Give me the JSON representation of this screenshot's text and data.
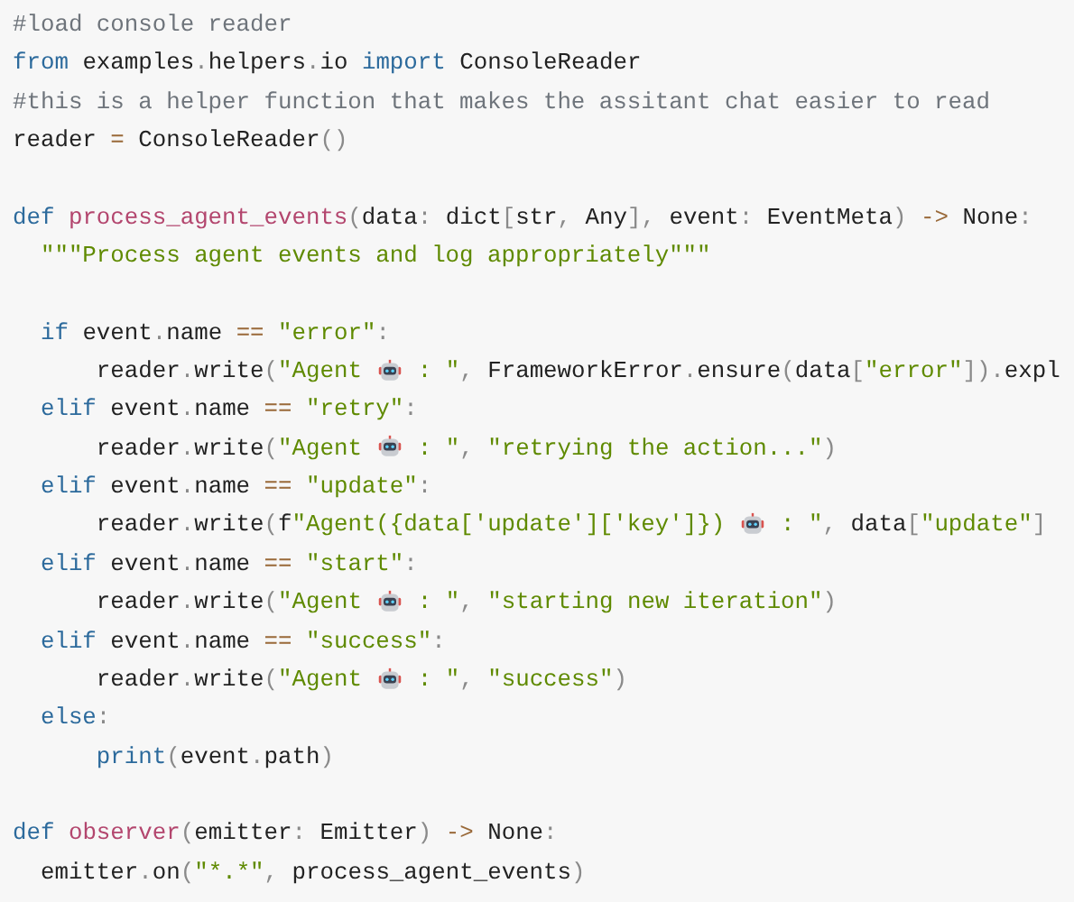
{
  "code_lines": [
    {
      "kind": "code",
      "tokens": [
        {
          "kind": "comment",
          "text": "#load console reader"
        }
      ]
    },
    {
      "kind": "code",
      "tokens": [
        {
          "kind": "keyword",
          "text": "from"
        },
        {
          "kind": "plain",
          "text": " examples"
        },
        {
          "kind": "punct",
          "text": "."
        },
        {
          "kind": "plain",
          "text": "helpers"
        },
        {
          "kind": "punct",
          "text": "."
        },
        {
          "kind": "plain",
          "text": "io "
        },
        {
          "kind": "keyword",
          "text": "import"
        },
        {
          "kind": "plain",
          "text": " ConsoleReader"
        }
      ]
    },
    {
      "kind": "code",
      "tokens": [
        {
          "kind": "comment",
          "text": "#this is a helper function that makes the assitant chat easier to read"
        }
      ]
    },
    {
      "kind": "code",
      "tokens": [
        {
          "kind": "plain",
          "text": "reader "
        },
        {
          "kind": "op",
          "text": "="
        },
        {
          "kind": "plain",
          "text": " ConsoleReader"
        },
        {
          "kind": "punct",
          "text": "()"
        }
      ]
    },
    {
      "kind": "blank"
    },
    {
      "kind": "code",
      "tokens": [
        {
          "kind": "keyword",
          "text": "def "
        },
        {
          "kind": "function",
          "text": "process_agent_events"
        },
        {
          "kind": "punct",
          "text": "("
        },
        {
          "kind": "plain",
          "text": "data"
        },
        {
          "kind": "punct",
          "text": ":"
        },
        {
          "kind": "plain",
          "text": " dict"
        },
        {
          "kind": "punct",
          "text": "["
        },
        {
          "kind": "plain",
          "text": "str"
        },
        {
          "kind": "punct",
          "text": ","
        },
        {
          "kind": "plain",
          "text": " Any"
        },
        {
          "kind": "punct",
          "text": "],"
        },
        {
          "kind": "plain",
          "text": " event"
        },
        {
          "kind": "punct",
          "text": ":"
        },
        {
          "kind": "plain",
          "text": " EventMeta"
        },
        {
          "kind": "punct",
          "text": ") "
        },
        {
          "kind": "op",
          "text": "->"
        },
        {
          "kind": "plain",
          "text": " None"
        },
        {
          "kind": "punct",
          "text": ":"
        }
      ]
    },
    {
      "kind": "code",
      "tokens": [
        {
          "kind": "string",
          "text": "  \"\"\"Process agent events and log appropriately\"\"\""
        }
      ]
    },
    {
      "kind": "blank"
    },
    {
      "kind": "code",
      "tokens": [
        {
          "kind": "keyword",
          "text": "  if"
        },
        {
          "kind": "plain",
          "text": " event"
        },
        {
          "kind": "punct",
          "text": "."
        },
        {
          "kind": "plain",
          "text": "name "
        },
        {
          "kind": "op",
          "text": "=="
        },
        {
          "kind": "string",
          "text": " \"error\""
        },
        {
          "kind": "punct",
          "text": ":"
        }
      ]
    },
    {
      "kind": "code",
      "tokens": [
        {
          "kind": "plain",
          "text": "      reader"
        },
        {
          "kind": "punct",
          "text": "."
        },
        {
          "kind": "plain",
          "text": "write"
        },
        {
          "kind": "punct",
          "text": "("
        },
        {
          "kind": "string",
          "text": "\"Agent "
        },
        {
          "kind": "robot"
        },
        {
          "kind": "string",
          "text": " : \""
        },
        {
          "kind": "punct",
          "text": ","
        },
        {
          "kind": "plain",
          "text": " FrameworkError"
        },
        {
          "kind": "punct",
          "text": "."
        },
        {
          "kind": "plain",
          "text": "ensure"
        },
        {
          "kind": "punct",
          "text": "("
        },
        {
          "kind": "plain",
          "text": "data"
        },
        {
          "kind": "punct",
          "text": "["
        },
        {
          "kind": "string",
          "text": "\"error\""
        },
        {
          "kind": "punct",
          "text": "])."
        },
        {
          "kind": "plain",
          "text": "expl"
        }
      ]
    },
    {
      "kind": "code",
      "tokens": [
        {
          "kind": "keyword",
          "text": "  elif"
        },
        {
          "kind": "plain",
          "text": " event"
        },
        {
          "kind": "punct",
          "text": "."
        },
        {
          "kind": "plain",
          "text": "name "
        },
        {
          "kind": "op",
          "text": "=="
        },
        {
          "kind": "string",
          "text": " \"retry\""
        },
        {
          "kind": "punct",
          "text": ":"
        }
      ]
    },
    {
      "kind": "code",
      "tokens": [
        {
          "kind": "plain",
          "text": "      reader"
        },
        {
          "kind": "punct",
          "text": "."
        },
        {
          "kind": "plain",
          "text": "write"
        },
        {
          "kind": "punct",
          "text": "("
        },
        {
          "kind": "string",
          "text": "\"Agent "
        },
        {
          "kind": "robot"
        },
        {
          "kind": "string",
          "text": " : \""
        },
        {
          "kind": "punct",
          "text": ","
        },
        {
          "kind": "string",
          "text": " \"retrying the action...\""
        },
        {
          "kind": "punct",
          "text": ")"
        }
      ]
    },
    {
      "kind": "code",
      "tokens": [
        {
          "kind": "keyword",
          "text": "  elif"
        },
        {
          "kind": "plain",
          "text": " event"
        },
        {
          "kind": "punct",
          "text": "."
        },
        {
          "kind": "plain",
          "text": "name "
        },
        {
          "kind": "op",
          "text": "=="
        },
        {
          "kind": "string",
          "text": " \"update\""
        },
        {
          "kind": "punct",
          "text": ":"
        }
      ]
    },
    {
      "kind": "code",
      "tokens": [
        {
          "kind": "plain",
          "text": "      reader"
        },
        {
          "kind": "punct",
          "text": "."
        },
        {
          "kind": "plain",
          "text": "write"
        },
        {
          "kind": "punct",
          "text": "("
        },
        {
          "kind": "plain",
          "text": "f"
        },
        {
          "kind": "string",
          "text": "\"Agent({data['update']['key']}) "
        },
        {
          "kind": "robot"
        },
        {
          "kind": "string",
          "text": " : \""
        },
        {
          "kind": "punct",
          "text": ","
        },
        {
          "kind": "plain",
          "text": " data"
        },
        {
          "kind": "punct",
          "text": "["
        },
        {
          "kind": "string",
          "text": "\"update\""
        },
        {
          "kind": "punct",
          "text": "]"
        }
      ]
    },
    {
      "kind": "code",
      "tokens": [
        {
          "kind": "keyword",
          "text": "  elif"
        },
        {
          "kind": "plain",
          "text": " event"
        },
        {
          "kind": "punct",
          "text": "."
        },
        {
          "kind": "plain",
          "text": "name "
        },
        {
          "kind": "op",
          "text": "=="
        },
        {
          "kind": "string",
          "text": " \"start\""
        },
        {
          "kind": "punct",
          "text": ":"
        }
      ]
    },
    {
      "kind": "code",
      "tokens": [
        {
          "kind": "plain",
          "text": "      reader"
        },
        {
          "kind": "punct",
          "text": "."
        },
        {
          "kind": "plain",
          "text": "write"
        },
        {
          "kind": "punct",
          "text": "("
        },
        {
          "kind": "string",
          "text": "\"Agent "
        },
        {
          "kind": "robot"
        },
        {
          "kind": "string",
          "text": " : \""
        },
        {
          "kind": "punct",
          "text": ","
        },
        {
          "kind": "string",
          "text": " \"starting new iteration\""
        },
        {
          "kind": "punct",
          "text": ")"
        }
      ]
    },
    {
      "kind": "code",
      "tokens": [
        {
          "kind": "keyword",
          "text": "  elif"
        },
        {
          "kind": "plain",
          "text": " event"
        },
        {
          "kind": "punct",
          "text": "."
        },
        {
          "kind": "plain",
          "text": "name "
        },
        {
          "kind": "op",
          "text": "=="
        },
        {
          "kind": "string",
          "text": " \"success\""
        },
        {
          "kind": "punct",
          "text": ":"
        }
      ]
    },
    {
      "kind": "code",
      "tokens": [
        {
          "kind": "plain",
          "text": "      reader"
        },
        {
          "kind": "punct",
          "text": "."
        },
        {
          "kind": "plain",
          "text": "write"
        },
        {
          "kind": "punct",
          "text": "("
        },
        {
          "kind": "string",
          "text": "\"Agent "
        },
        {
          "kind": "robot"
        },
        {
          "kind": "string",
          "text": " : \""
        },
        {
          "kind": "punct",
          "text": ","
        },
        {
          "kind": "string",
          "text": " \"success\""
        },
        {
          "kind": "punct",
          "text": ")"
        }
      ]
    },
    {
      "kind": "code",
      "tokens": [
        {
          "kind": "keyword",
          "text": "  else"
        },
        {
          "kind": "punct",
          "text": ":"
        }
      ]
    },
    {
      "kind": "code",
      "tokens": [
        {
          "kind": "keyword",
          "text": "      print"
        },
        {
          "kind": "punct",
          "text": "("
        },
        {
          "kind": "plain",
          "text": "event"
        },
        {
          "kind": "punct",
          "text": "."
        },
        {
          "kind": "plain",
          "text": "path"
        },
        {
          "kind": "punct",
          "text": ")"
        }
      ]
    },
    {
      "kind": "blank"
    },
    {
      "kind": "code",
      "tokens": [
        {
          "kind": "keyword",
          "text": "def "
        },
        {
          "kind": "function",
          "text": "observer"
        },
        {
          "kind": "punct",
          "text": "("
        },
        {
          "kind": "plain",
          "text": "emitter"
        },
        {
          "kind": "punct",
          "text": ":"
        },
        {
          "kind": "plain",
          "text": " Emitter"
        },
        {
          "kind": "punct",
          "text": ") "
        },
        {
          "kind": "op",
          "text": "->"
        },
        {
          "kind": "plain",
          "text": " None"
        },
        {
          "kind": "punct",
          "text": ":"
        }
      ]
    },
    {
      "kind": "code",
      "tokens": [
        {
          "kind": "plain",
          "text": "  emitter"
        },
        {
          "kind": "punct",
          "text": "."
        },
        {
          "kind": "plain",
          "text": "on"
        },
        {
          "kind": "punct",
          "text": "("
        },
        {
          "kind": "string",
          "text": "\"*.*\""
        },
        {
          "kind": "punct",
          "text": ","
        },
        {
          "kind": "plain",
          "text": " process_agent_events"
        },
        {
          "kind": "punct",
          "text": ")"
        }
      ]
    }
  ]
}
